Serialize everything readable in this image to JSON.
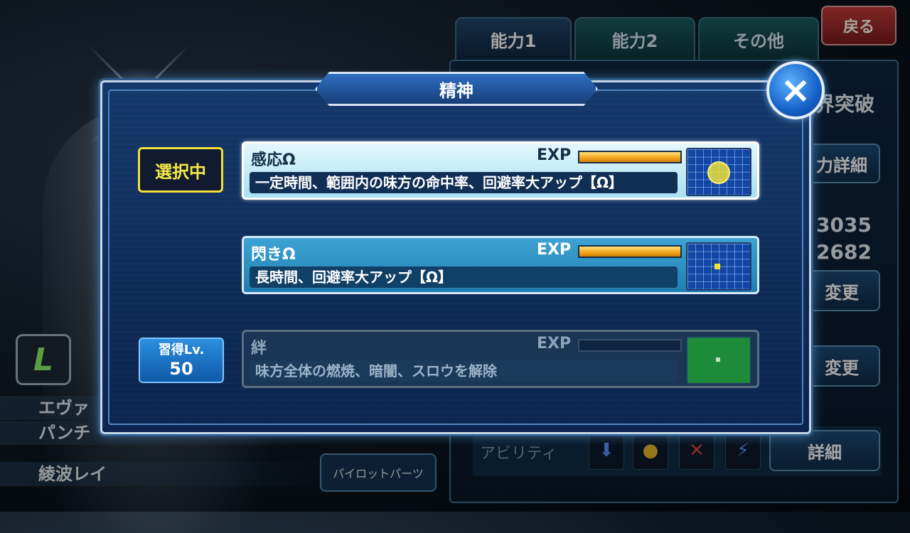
{
  "background": {
    "tabs": [
      "能力1",
      "能力2",
      "その他"
    ],
    "back_label": "戻る",
    "limit_break_label": "界突破",
    "ability_detail_label": "力詳細",
    "stat_1": "3035",
    "stat_2": "2682",
    "change_label_1": "変更",
    "change_label_2": "変更",
    "ability_label": "アビリティ",
    "detail_label": "詳細",
    "left_rows": [
      "エヴァ",
      "パンチ",
      "綾波レイ"
    ],
    "pilot_parts_label": "パイロットパーツ",
    "l_badge": "L"
  },
  "modal": {
    "title": "精神",
    "close_icon": "×",
    "selected_badge": "選択中",
    "learn_level": {
      "label": "習得Lv.",
      "value": "50"
    },
    "skills": [
      {
        "name": "感応Ω",
        "exp_label": "EXP",
        "description": "一定時間、範囲内の味方の命中率、回避率大アップ【Ω】",
        "state": "selected"
      },
      {
        "name": "閃きΩ",
        "exp_label": "EXP",
        "description": "長時間、回避率大アップ【Ω】",
        "state": "available"
      },
      {
        "name": "絆",
        "exp_label": "EXP",
        "description": "味方全体の燃焼、暗闇、スロウを解除",
        "state": "locked"
      }
    ]
  },
  "colors": {
    "accent_gold": "#f2a31b",
    "selected_yellow": "#f5e84a",
    "close_blue": "#1562c8"
  }
}
